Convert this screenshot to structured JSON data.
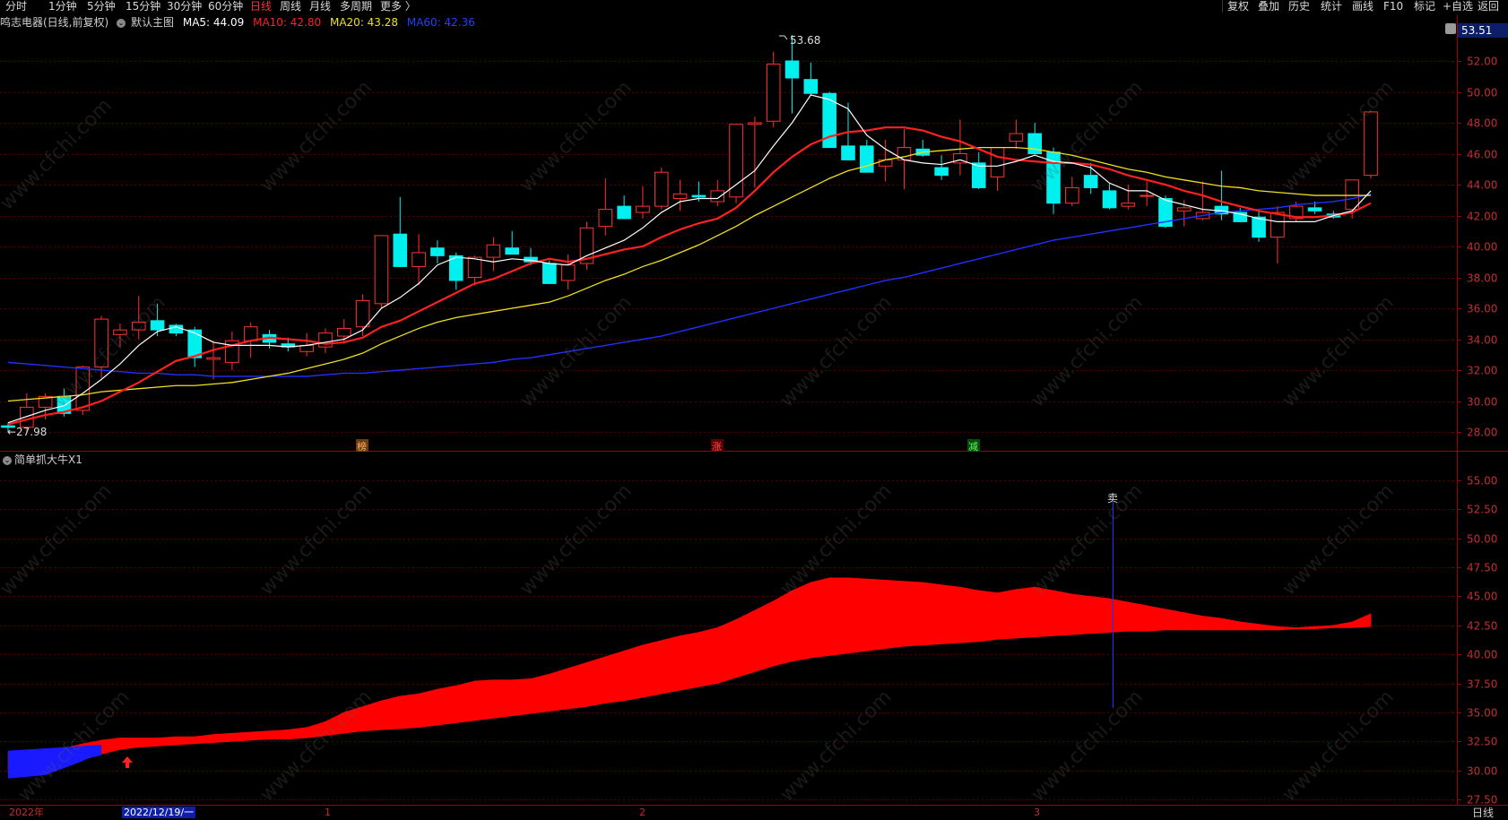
{
  "toolbar": {
    "periods": [
      "分时",
      "1分钟",
      "5分钟",
      "15分钟",
      "30分钟",
      "60分钟",
      "日线",
      "周线",
      "月线",
      "多周期",
      "更多"
    ],
    "active_period": "日线",
    "right_items": [
      "复权",
      "叠加",
      "历史",
      "统计",
      "画线",
      "F10",
      "标记",
      "+自选",
      "返回"
    ]
  },
  "main_chart": {
    "title": "鸣志电器(日线,前复权)",
    "template": "默认主图",
    "ma_labels": [
      {
        "text": "MA5: 44.09",
        "color": "#ffffff"
      },
      {
        "text": "MA10: 42.80",
        "color": "#ff2020"
      },
      {
        "text": "MA20: 43.28",
        "color": "#f0e020"
      },
      {
        "text": "MA60: 42.36",
        "color": "#2040ff"
      }
    ],
    "current_price": "53.51",
    "y_ticks": [
      "52.00",
      "50.00",
      "48.00",
      "46.00",
      "44.00",
      "42.00",
      "40.00",
      "38.00",
      "36.00",
      "34.00",
      "32.00",
      "30.00",
      "28.00"
    ],
    "high_label": "53.68",
    "low_label": "←27.98",
    "markers": [
      "榜",
      "涨",
      "减"
    ]
  },
  "chart_data": [
    {
      "type": "candlestick",
      "ylim": [
        27,
        54
      ],
      "candles": [
        [
          28.4,
          28.6,
          27.98,
          28.3
        ],
        [
          28.3,
          30.5,
          28,
          29.6
        ],
        [
          29.6,
          30.5,
          28.8,
          30.3
        ],
        [
          30.3,
          30.8,
          29,
          29.2
        ],
        [
          29.4,
          32.3,
          29.1,
          32.2
        ],
        [
          32.2,
          35.5,
          31.5,
          35.3
        ],
        [
          34.3,
          35,
          33.5,
          34.6
        ],
        [
          34.6,
          36.8,
          34,
          35.1
        ],
        [
          35.2,
          36.3,
          34.2,
          34.6
        ],
        [
          34.9,
          35,
          34.2,
          34.4
        ],
        [
          34.6,
          34.8,
          32.2,
          32.8
        ],
        [
          32.7,
          33.9,
          31.4,
          32.8
        ],
        [
          32.5,
          34.5,
          32,
          33.9
        ],
        [
          33.9,
          35.1,
          32.8,
          34.8
        ],
        [
          34.3,
          34.6,
          33.4,
          33.8
        ],
        [
          33.7,
          34.1,
          33.2,
          33.5
        ],
        [
          33.2,
          34.4,
          32.9,
          33.6
        ],
        [
          33.5,
          34.7,
          33.1,
          34.4
        ],
        [
          34.2,
          35.3,
          33.7,
          34.7
        ],
        [
          34.8,
          36.9,
          34.2,
          36.5
        ],
        [
          36.3,
          40.4,
          36,
          40.7
        ],
        [
          40.8,
          43.2,
          38.9,
          38.7
        ],
        [
          38.7,
          40.8,
          37.5,
          39.6
        ],
        [
          39.9,
          40.4,
          38.9,
          39.4
        ],
        [
          39.4,
          39.6,
          37.2,
          37.8
        ],
        [
          38,
          39.4,
          37.5,
          39.3
        ],
        [
          39.3,
          40.6,
          38.4,
          40.1
        ],
        [
          39.9,
          41,
          39.6,
          39.5
        ],
        [
          39.3,
          39.9,
          38.8,
          39
        ],
        [
          38.9,
          39.1,
          37.6,
          37.6
        ],
        [
          37.8,
          39.5,
          37.2,
          38.8
        ],
        [
          38.9,
          41.6,
          38.5,
          41.2
        ],
        [
          41.3,
          44.4,
          40.7,
          42.4
        ],
        [
          42.6,
          43.3,
          41.9,
          41.8
        ],
        [
          42.2,
          43.9,
          41.8,
          42.6
        ],
        [
          42.6,
          45.1,
          42.4,
          44.8
        ],
        [
          43.1,
          44.3,
          42.3,
          43.4
        ],
        [
          43.3,
          44.2,
          42.9,
          43.2
        ],
        [
          42.9,
          44.3,
          42.6,
          43.6
        ],
        [
          43.2,
          47.9,
          42.8,
          47.9
        ],
        [
          47.9,
          48.4,
          43.8,
          48.0
        ],
        [
          48.1,
          52.6,
          47.7,
          51.8
        ],
        [
          52.0,
          53.68,
          48.6,
          50.9
        ],
        [
          50.8,
          51.9,
          49.8,
          49.9
        ],
        [
          49.9,
          50.0,
          46.4,
          46.4
        ],
        [
          46.5,
          49.3,
          45.6,
          45.6
        ],
        [
          46.5,
          46.9,
          44.8,
          44.8
        ],
        [
          45.2,
          46.9,
          44.2,
          45.6
        ],
        [
          45.6,
          47.6,
          43.7,
          46.4
        ],
        [
          46.3,
          46.9,
          45.8,
          45.9
        ],
        [
          45.1,
          45.9,
          44.3,
          44.6
        ],
        [
          45.4,
          48.2,
          44.6,
          46.0
        ],
        [
          45.4,
          46.1,
          43.7,
          43.8
        ],
        [
          44.5,
          46.3,
          43.6,
          46.4
        ],
        [
          46.8,
          48.2,
          46.3,
          47.3
        ],
        [
          47.3,
          48.0,
          45.9,
          46.0
        ],
        [
          46.1,
          46.4,
          42.1,
          42.8
        ],
        [
          42.8,
          44.5,
          42.6,
          43.8
        ],
        [
          44.6,
          45.4,
          43.4,
          43.8
        ],
        [
          43.6,
          44.1,
          42.4,
          42.5
        ],
        [
          42.6,
          44.0,
          42.4,
          42.8
        ],
        [
          43.3,
          44.2,
          42.6,
          43.3
        ],
        [
          43.1,
          43.3,
          41.2,
          41.3
        ],
        [
          42.3,
          43.0,
          41.3,
          42.5
        ],
        [
          41.8,
          44.2,
          41.7,
          42.2
        ],
        [
          42.6,
          44.9,
          41.7,
          42.1
        ],
        [
          42.2,
          42.5,
          41.6,
          41.6
        ],
        [
          41.9,
          42.3,
          40.3,
          40.6
        ],
        [
          40.6,
          42.6,
          38.9,
          42.2
        ],
        [
          41.8,
          42.9,
          41.6,
          42.6
        ],
        [
          42.5,
          42.9,
          42.1,
          42.3
        ],
        [
          42.1,
          42.3,
          41.8,
          41.9
        ],
        [
          42.4,
          43.5,
          41.8,
          44.3
        ],
        [
          44.6,
          48.8,
          44.4,
          48.7
        ]
      ],
      "ma5": [
        28.6,
        29.0,
        29.4,
        29.7,
        30.5,
        31.4,
        32.4,
        33.6,
        34.5,
        34.8,
        34.4,
        33.8,
        33.6,
        33.6,
        33.6,
        33.5,
        33.6,
        33.8,
        34.0,
        34.6,
        36.0,
        36.7,
        37.6,
        38.8,
        39.3,
        39.2,
        39.0,
        39.2,
        39.1,
        38.9,
        38.8,
        39.4,
        39.9,
        40.4,
        41.2,
        42.2,
        42.9,
        43.1,
        43.1,
        44.0,
        44.9,
        46.5,
        48.0,
        49.8,
        49.5,
        48.9,
        47.2,
        46.3,
        45.6,
        45.4,
        45.3,
        45.6,
        45.2,
        45.2,
        45.5,
        45.9,
        45.5,
        45.4,
        45.1,
        44.1,
        43.6,
        43.6,
        43.0,
        42.7,
        42.4,
        42.3,
        42.1,
        41.8,
        41.6,
        41.6,
        41.6,
        42.0,
        42.3,
        43.6
      ],
      "ma10": [
        28.5,
        28.8,
        29.1,
        29.3,
        29.6,
        30.0,
        30.6,
        31.2,
        31.9,
        32.6,
        32.9,
        33.3,
        33.6,
        33.9,
        34.1,
        34.0,
        33.9,
        33.7,
        33.8,
        34.1,
        34.8,
        35.2,
        35.8,
        36.4,
        37.0,
        37.6,
        37.9,
        38.4,
        38.9,
        39.2,
        39.0,
        39.2,
        39.5,
        39.8,
        40.0,
        40.6,
        41.1,
        41.5,
        41.8,
        42.5,
        43.6,
        44.8,
        45.8,
        46.6,
        47.1,
        47.4,
        47.5,
        47.7,
        47.7,
        47.5,
        47.1,
        46.8,
        46.3,
        45.8,
        45.6,
        45.5,
        45.4,
        45.4,
        45.3,
        45.0,
        44.6,
        44.3,
        44.0,
        43.6,
        43.3,
        42.9,
        42.6,
        42.3,
        42.1,
        41.9,
        41.9,
        42.0,
        42.2,
        42.8
      ],
      "ma20": [
        30.0,
        30.1,
        30.2,
        30.3,
        30.4,
        30.6,
        30.7,
        30.8,
        30.9,
        31.0,
        31.0,
        31.1,
        31.2,
        31.4,
        31.6,
        31.8,
        32.1,
        32.4,
        32.7,
        33.1,
        33.7,
        34.2,
        34.7,
        35.1,
        35.4,
        35.6,
        35.8,
        36.0,
        36.2,
        36.4,
        36.8,
        37.3,
        37.8,
        38.2,
        38.7,
        39.1,
        39.6,
        40.1,
        40.7,
        41.3,
        42.0,
        42.6,
        43.2,
        43.8,
        44.4,
        44.9,
        45.2,
        45.6,
        45.8,
        46.1,
        46.2,
        46.3,
        46.4,
        46.4,
        46.4,
        46.3,
        46.1,
        45.9,
        45.6,
        45.3,
        45.0,
        44.8,
        44.5,
        44.3,
        44.1,
        43.9,
        43.8,
        43.6,
        43.5,
        43.4,
        43.3,
        43.3,
        43.3,
        43.3
      ],
      "ma60": [
        32.5,
        32.4,
        32.3,
        32.2,
        32.1,
        32.0,
        31.9,
        31.8,
        31.8,
        31.7,
        31.7,
        31.6,
        31.6,
        31.6,
        31.6,
        31.6,
        31.6,
        31.7,
        31.8,
        31.8,
        31.9,
        32.0,
        32.1,
        32.2,
        32.3,
        32.4,
        32.5,
        32.7,
        32.8,
        33.0,
        33.2,
        33.4,
        33.6,
        33.8,
        34.0,
        34.2,
        34.5,
        34.8,
        35.1,
        35.4,
        35.7,
        36.0,
        36.3,
        36.6,
        36.9,
        37.2,
        37.5,
        37.8,
        38.0,
        38.3,
        38.6,
        38.9,
        39.2,
        39.5,
        39.8,
        40.1,
        40.4,
        40.6,
        40.8,
        41.0,
        41.2,
        41.4,
        41.6,
        41.8,
        42.0,
        42.2,
        42.3,
        42.4,
        42.5,
        42.7,
        42.8,
        42.9,
        43.1,
        43.4
      ]
    },
    {
      "type": "area",
      "ylim": [
        25.5,
        56.5
      ],
      "upper": [
        31.5,
        31.5,
        31.6,
        31.9,
        32.3,
        32.6,
        32.8,
        32.8,
        32.8,
        32.9,
        32.9,
        33.1,
        33.2,
        33.3,
        33.4,
        33.5,
        33.7,
        34.2,
        35.0,
        35.5,
        36.0,
        36.4,
        36.6,
        37.0,
        37.3,
        37.7,
        37.8,
        37.8,
        37.9,
        38.3,
        38.8,
        39.3,
        39.8,
        40.3,
        40.8,
        41.2,
        41.6,
        41.9,
        42.3,
        43.0,
        43.8,
        44.6,
        45.5,
        46.2,
        46.6,
        46.6,
        46.5,
        46.4,
        46.3,
        46.2,
        46.0,
        45.8,
        45.5,
        45.3,
        45.6,
        45.8,
        45.5,
        45.2,
        45.0,
        44.8,
        44.5,
        44.2,
        43.9,
        43.6,
        43.3,
        43.1,
        42.8,
        42.6,
        42.4,
        42.3,
        42.4,
        42.5,
        42.8,
        43.5
      ],
      "lower": [
        29.8,
        29.8,
        29.9,
        30.4,
        30.9,
        31.4,
        31.8,
        32.0,
        32.1,
        32.2,
        32.3,
        32.4,
        32.5,
        32.6,
        32.7,
        32.7,
        32.8,
        33.0,
        33.2,
        33.4,
        33.5,
        33.6,
        33.7,
        33.9,
        34.1,
        34.3,
        34.5,
        34.7,
        34.9,
        35.1,
        35.3,
        35.5,
        35.8,
        36.0,
        36.3,
        36.6,
        36.9,
        37.2,
        37.5,
        38.0,
        38.5,
        39.0,
        39.4,
        39.7,
        39.9,
        40.1,
        40.3,
        40.5,
        40.7,
        40.8,
        40.9,
        41.0,
        41.1,
        41.3,
        41.4,
        41.5,
        41.6,
        41.7,
        41.8,
        41.9,
        42.0,
        42.0,
        42.1,
        42.1,
        42.1,
        42.1,
        42.1,
        42.1,
        42.1,
        42.2,
        42.2,
        42.3,
        42.3,
        42.4
      ],
      "y_ticks": [
        "55.00",
        "52.50",
        "50.00",
        "47.50",
        "45.00",
        "42.50",
        "40.00",
        "37.50",
        "35.00",
        "32.50",
        "30.00",
        "27.50"
      ]
    }
  ],
  "indicator": {
    "name": "简单抓大牛X1",
    "sell_label": "卖"
  },
  "time_axis": {
    "labels": [
      "2022年",
      "2022/12/19/一",
      "1",
      "2",
      "3"
    ],
    "period": "日线"
  },
  "watermark": "www.cfchi.com",
  "colors": {
    "up": "#ff3232",
    "down": "#00f0f0",
    "grid": "#5a0000",
    "axis": "#a00000",
    "ma5": "#ffffff",
    "ma10": "#ff2020",
    "ma20": "#f0e020",
    "ma60": "#2030ff",
    "band_up": "#ff0000",
    "band_down": "#1a1aff"
  }
}
